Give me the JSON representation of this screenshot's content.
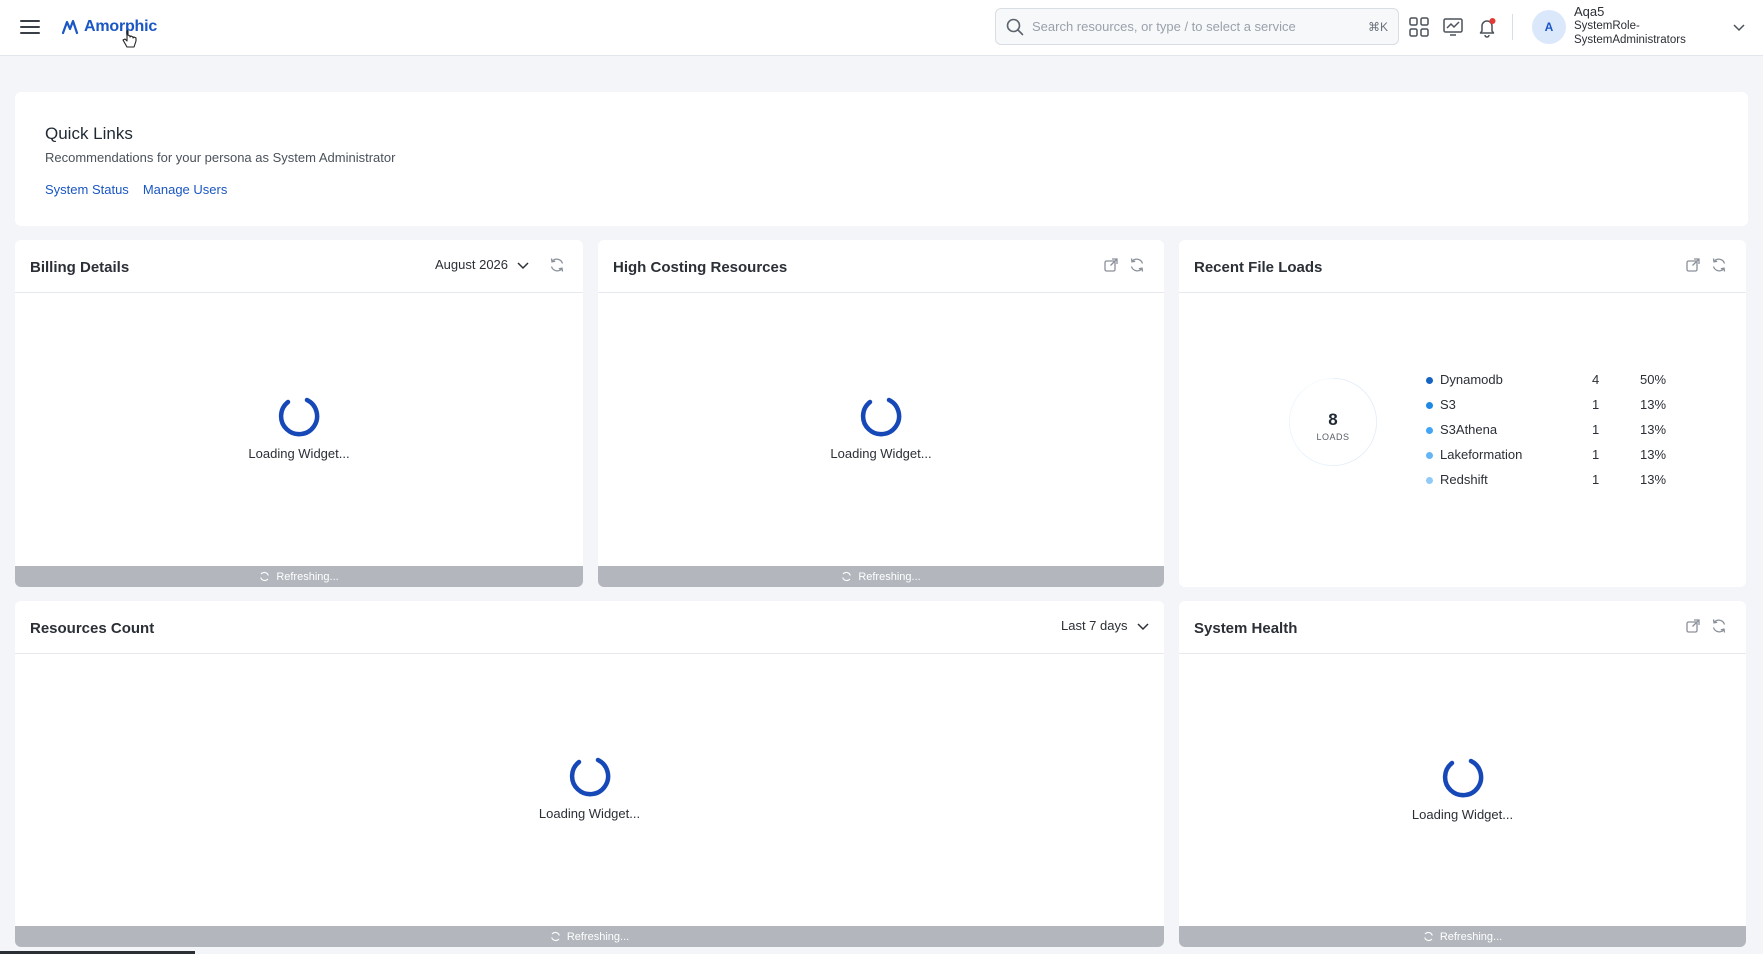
{
  "app": {
    "logo_text": "Amorphic"
  },
  "search": {
    "placeholder": "Search resources, or type / to select a service",
    "shortcut": "⌘K"
  },
  "user": {
    "initial": "A",
    "name": "Aqa5",
    "role_line1": "SystemRole-",
    "role_line2": "SystemAdministrators"
  },
  "quick_links": {
    "title": "Quick Links",
    "subtitle": "Recommendations for your persona as System Administrator",
    "links": [
      "System Status",
      "Manage Users"
    ]
  },
  "widgets": {
    "loading_text": "Loading Widget...",
    "refreshing_text": "Refreshing...",
    "billing": {
      "title": "Billing Details",
      "period": "August 2026"
    },
    "high_cost": {
      "title": "High Costing Resources"
    },
    "recent_loads": {
      "title": "Recent File Loads",
      "total": "8",
      "total_label": "LOADS"
    },
    "resources": {
      "title": "Resources Count",
      "range": "Last 7 days"
    },
    "health": {
      "title": "System Health"
    }
  },
  "chart_data": {
    "type": "pie",
    "categories": [
      "Dynamodb",
      "S3",
      "S3Athena",
      "Lakeformation",
      "Redshift"
    ],
    "values": [
      4,
      1,
      1,
      1,
      1
    ],
    "percents": [
      "50%",
      "13%",
      "13%",
      "13%",
      "13%"
    ],
    "colors": [
      "#1565c0",
      "#1e88e5",
      "#42a5f5",
      "#64b5f6",
      "#90caf9"
    ]
  }
}
